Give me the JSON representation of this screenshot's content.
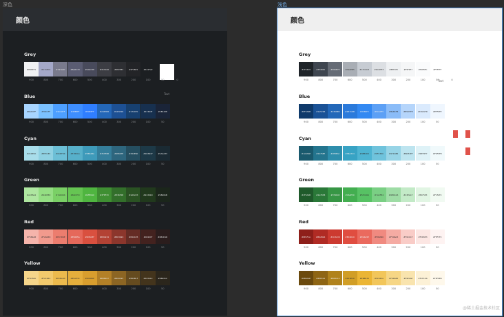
{
  "tabs": {
    "dark": "深色",
    "light": "浅色"
  },
  "header_title": "颜色",
  "text_label": "Text",
  "watermark": "@稀土掘金技术社区",
  "levels": [
    "900",
    "800",
    "700",
    "600",
    "500",
    "400",
    "300",
    "200",
    "100",
    "50"
  ],
  "grey_levels": [
    "900",
    "800",
    "700",
    "600",
    "500",
    "400",
    "300",
    "200",
    "100",
    "50",
    "0"
  ],
  "dark": {
    "groups": [
      {
        "name": "Grey",
        "swatches": [
          {
            "hex": "#F0F1F3",
            "label": "#EDEEF1"
          },
          {
            "hex": "#A4A8C8",
            "label": "#A7A8C4"
          },
          {
            "hex": "#797A8C",
            "label": "#797A8C"
          },
          {
            "hex": "#5A5C72",
            "label": "#6A6C70"
          },
          {
            "hex": "#484A5B",
            "label": "#4A4C58"
          },
          {
            "hex": "#3C3D43",
            "label": "#3C3C40"
          },
          {
            "hex": "#2E2F33",
            "label": "#2E2E33"
          },
          {
            "hex": "#232427",
            "label": "#1F1B21"
          },
          {
            "hex": "#1C1F22",
            "label": "#1C1F22"
          }
        ]
      },
      {
        "name": "Blue",
        "swatches": [
          {
            "hex": "#A8D5FF",
            "label": "#BAD0FF"
          },
          {
            "hex": "#7BC1FF",
            "label": "#7BC1FF"
          },
          {
            "hex": "#4D9FFF",
            "label": "#4CA0FF"
          },
          {
            "hex": "#3E8EFF",
            "label": "#3E8EFF"
          },
          {
            "hex": "#2F7EFF",
            "label": "#3085FF"
          },
          {
            "hex": "#2467B8",
            "label": "#2467B8"
          },
          {
            "hex": "#1D5094",
            "label": "#1D5094"
          },
          {
            "hex": "#174070",
            "label": "#174070"
          },
          {
            "hex": "#17304F",
            "label": "#17304F"
          },
          {
            "hex": "#1A2438",
            "label": "#1E2438"
          }
        ]
      },
      {
        "name": "Cyan",
        "swatches": [
          {
            "hex": "#A8DDEA",
            "label": "#A5DEEA"
          },
          {
            "hex": "#8FD1E2",
            "label": "#8FD1E2"
          },
          {
            "hex": "#6CBFD6",
            "label": "#6CBFD6"
          },
          {
            "hex": "#57B0CA",
            "label": "#57B0CA"
          },
          {
            "hex": "#3E9ABA",
            "label": "#3E9ABA"
          },
          {
            "hex": "#357E9B",
            "label": "#357E9B"
          },
          {
            "hex": "#2E667E",
            "label": "#2E667E"
          },
          {
            "hex": "#254E60",
            "label": "#254E60"
          },
          {
            "hex": "#1D3947",
            "label": "#1D3947"
          },
          {
            "hex": "#1A2A33",
            "label": "#1A2A33"
          }
        ]
      },
      {
        "name": "Green",
        "swatches": [
          {
            "hex": "#AEE6A0",
            "label": "#ACE8A4"
          },
          {
            "hex": "#94DE83",
            "label": "#94DE83"
          },
          {
            "hex": "#7AD066",
            "label": "#7AD066"
          },
          {
            "hex": "#66C553",
            "label": "#66C553"
          },
          {
            "hex": "#4FB540",
            "label": "#4FB540"
          },
          {
            "hex": "#3F8F33",
            "label": "#3F8F33"
          },
          {
            "hex": "#336F2B",
            "label": "#336F2B"
          },
          {
            "hex": "#2A5223",
            "label": "#2A5223"
          },
          {
            "hex": "#21391D",
            "label": "#21391D"
          },
          {
            "hex": "#1B261B",
            "label": "#1B261B"
          }
        ]
      },
      {
        "name": "Red",
        "swatches": [
          {
            "hex": "#F5B4AB",
            "label": "#F5B4AB"
          },
          {
            "hex": "#F29A8D",
            "label": "#F29A8D"
          },
          {
            "hex": "#EC7D6E",
            "label": "#EC7D6E"
          },
          {
            "hex": "#E5685A",
            "label": "#E5685A"
          },
          {
            "hex": "#D9503F",
            "label": "#D9503F"
          },
          {
            "hex": "#B34234",
            "label": "#B34234"
          },
          {
            "hex": "#8C362C",
            "label": "#8C362C"
          },
          {
            "hex": "#652C25",
            "label": "#652C25"
          },
          {
            "hex": "#43221F",
            "label": "#43221F"
          },
          {
            "hex": "#2B1D1D",
            "label": "#2B1D1D"
          }
        ]
      },
      {
        "name": "Yellow",
        "swatches": [
          {
            "hex": "#F5D58A",
            "label": "#F5D58A"
          },
          {
            "hex": "#F2C96C",
            "label": "#F2C96C"
          },
          {
            "hex": "#ECBA4D",
            "label": "#ECBA4D"
          },
          {
            "hex": "#E5AE3C",
            "label": "#E5AE3C"
          },
          {
            "hex": "#D99E2E",
            "label": "#D99E2E"
          },
          {
            "hex": "#B38027",
            "label": "#B38027"
          },
          {
            "hex": "#8C6523",
            "label": "#8C6523"
          },
          {
            "hex": "#654B1F",
            "label": "#654B1F"
          },
          {
            "hex": "#43341C",
            "label": "#43341C"
          },
          {
            "hex": "#2B261C",
            "label": "#2B261C"
          }
        ]
      }
    ]
  },
  "light": {
    "groups": [
      {
        "name": "Grey",
        "swatches": [
          {
            "hex": "#1F2429",
            "label": "#1F2429"
          },
          {
            "hex": "#3F4650",
            "label": "#3F4650"
          },
          {
            "hex": "#656B75",
            "label": "#656B75"
          },
          {
            "hex": "#A9AEB5",
            "label": "#A9AEB5"
          },
          {
            "hex": "#C7CCD3",
            "label": "#C7CCD3"
          },
          {
            "hex": "#DCDFE3",
            "label": "#DCDFE3"
          },
          {
            "hex": "#EEF0F2",
            "label": "#EEF0F2"
          },
          {
            "hex": "#F5F6F7",
            "label": "#F5F6F7"
          },
          {
            "hex": "#FAFBFC",
            "label": "#FAFBFC"
          },
          {
            "hex": "#FFFFFF",
            "label": "#FFFFFF"
          }
        ]
      },
      {
        "name": "Blue",
        "swatches": [
          {
            "hex": "#0F3A6B",
            "label": "#0F3A6B"
          },
          {
            "hex": "#1A5296",
            "label": "#1A5296"
          },
          {
            "hex": "#2368B9",
            "label": "#2368B9"
          },
          {
            "hex": "#2B7ADB",
            "label": "#2B7ADB"
          },
          {
            "hex": "#3389F2",
            "label": "#3389F2"
          },
          {
            "hex": "#5CA0F5",
            "label": "#5CA0F5"
          },
          {
            "hex": "#8ABCF8",
            "label": "#8ABCF8"
          },
          {
            "hex": "#B5D5FB",
            "label": "#B5D5FB"
          },
          {
            "hex": "#DAEAFD",
            "label": "#DAEAFD"
          },
          {
            "hex": "#EFF6FE",
            "label": "#EFF6FE"
          }
        ]
      },
      {
        "name": "Cyan",
        "swatches": [
          {
            "hex": "#1A5A6E",
            "label": "#1A5A6E"
          },
          {
            "hex": "#24758E",
            "label": "#24758E"
          },
          {
            "hex": "#2E8EAC",
            "label": "#2E8EAC"
          },
          {
            "hex": "#38A3C4",
            "label": "#38A3C4"
          },
          {
            "hex": "#4EB4D2",
            "label": "#4EB4D2"
          },
          {
            "hex": "#6FC3DC",
            "label": "#6FC3DC"
          },
          {
            "hex": "#97D4E6",
            "label": "#97D4E6"
          },
          {
            "hex": "#BDE4EF",
            "label": "#BDE4EF"
          },
          {
            "hex": "#DEF2F7",
            "label": "#DEF2F7"
          },
          {
            "hex": "#F0F9FB",
            "label": "#F0F9FB"
          }
        ]
      },
      {
        "name": "Green",
        "swatches": [
          {
            "hex": "#1F5A2B",
            "label": "#1F5A2B"
          },
          {
            "hex": "#2A7838",
            "label": "#2A7838"
          },
          {
            "hex": "#379645",
            "label": "#379645"
          },
          {
            "hex": "#43AE50",
            "label": "#43AE50"
          },
          {
            "hex": "#57C264",
            "label": "#57C264"
          },
          {
            "hex": "#7ACF84",
            "label": "#7ACF84"
          },
          {
            "hex": "#9EDCA5",
            "label": "#9EDCA5"
          },
          {
            "hex": "#C3EAC7",
            "label": "#C3EAC7"
          },
          {
            "hex": "#E1F5E3",
            "label": "#E1F5E3"
          },
          {
            "hex": "#F1FAF2",
            "label": "#F1FAF2"
          }
        ]
      },
      {
        "name": "Red",
        "swatches": [
          {
            "hex": "#8E1F1A",
            "label": "#8E1F1A"
          },
          {
            "hex": "#B02B24",
            "label": "#B02B24"
          },
          {
            "hex": "#CC3A30",
            "label": "#CC3A30"
          },
          {
            "hex": "#E04D40",
            "label": "#E04D40"
          },
          {
            "hex": "#EA6A5E",
            "label": "#EA6A5E"
          },
          {
            "hex": "#F08A80",
            "label": "#F08A80"
          },
          {
            "hex": "#F5ABA3",
            "label": "#F5ABA3"
          },
          {
            "hex": "#F9CCC7",
            "label": "#F9CCC7"
          },
          {
            "hex": "#FCE6E3",
            "label": "#FCE6E3"
          },
          {
            "hex": "#FEF3F2",
            "label": "#FEF3F2"
          }
        ]
      },
      {
        "name": "Yellow",
        "swatches": [
          {
            "hex": "#6B4A0E",
            "label": "#6B4A0E"
          },
          {
            "hex": "#8E6514",
            "label": "#8E6514"
          },
          {
            "hex": "#B0821C",
            "label": "#B0821C"
          },
          {
            "hex": "#D19E26",
            "label": "#D19E26"
          },
          {
            "hex": "#EBB534",
            "label": "#EBB534"
          },
          {
            "hex": "#F2C65A",
            "label": "#F2C65A"
          },
          {
            "hex": "#F6D685",
            "label": "#F6D685"
          },
          {
            "hex": "#F9E4AE",
            "label": "#F9E4AE"
          },
          {
            "hex": "#FCF1D6",
            "label": "#FCF1D6"
          },
          {
            "hex": "#FEF8EB",
            "label": "#FEF8EB"
          }
        ]
      }
    ]
  }
}
